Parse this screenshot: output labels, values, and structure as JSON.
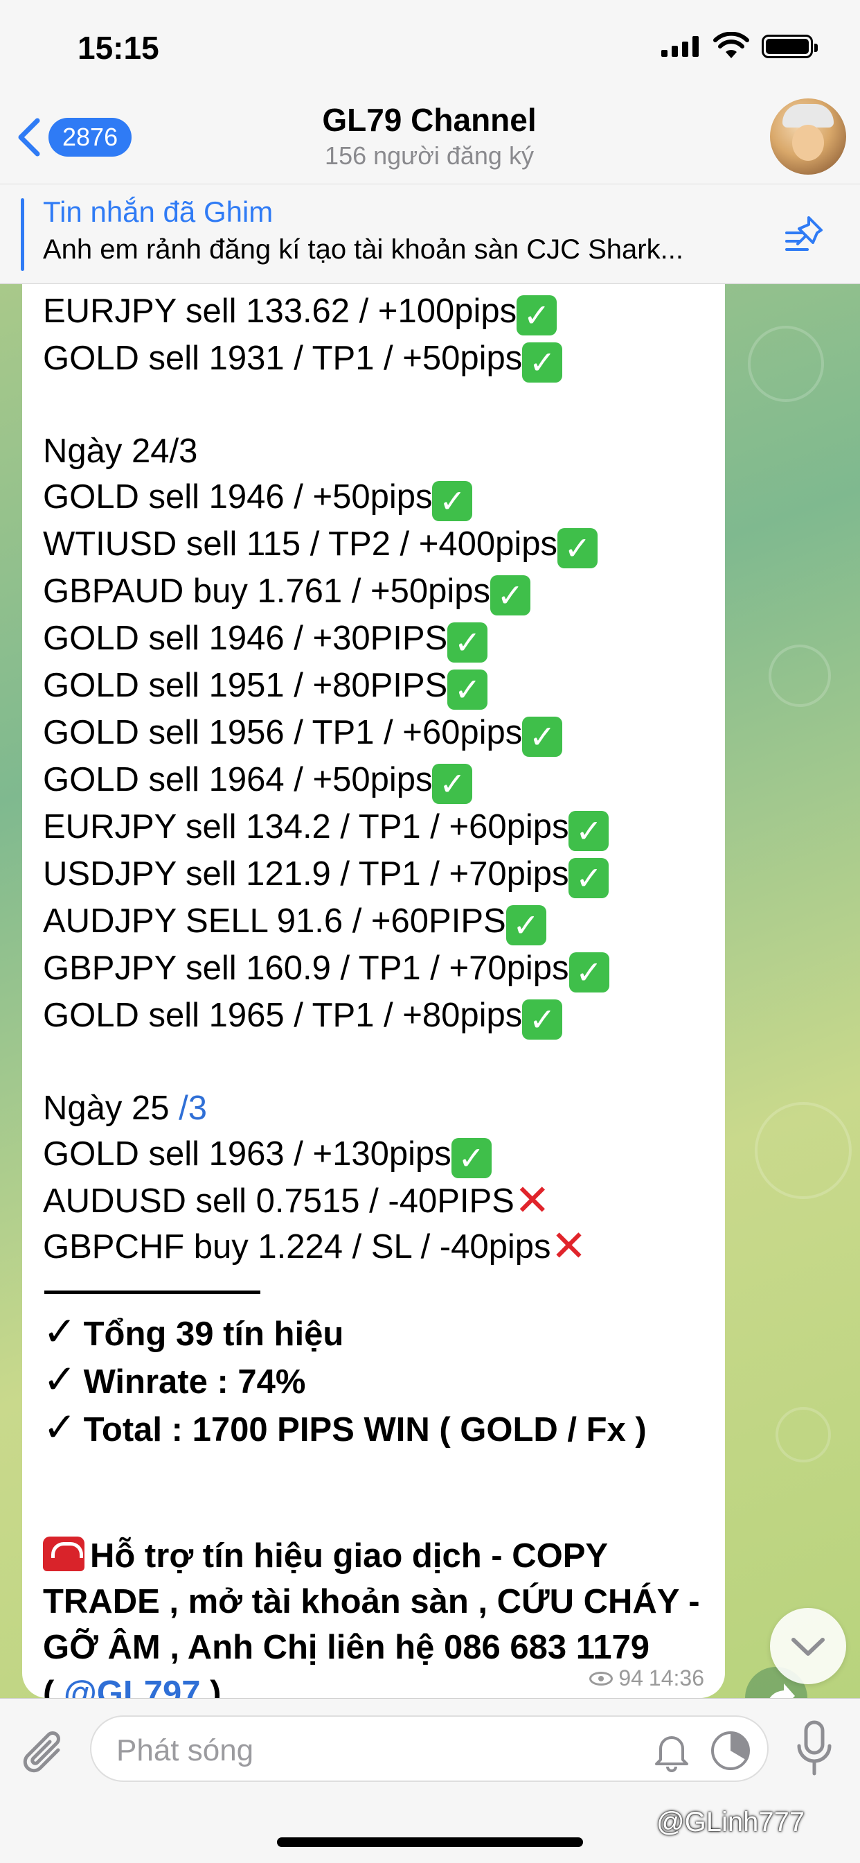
{
  "status": {
    "time": "15:15"
  },
  "header": {
    "back_count": "2876",
    "title": "GL79 Channel",
    "subtitle": "156 người đăng ký"
  },
  "pinned": {
    "title": "Tin nhắn đã Ghim",
    "text": "Anh em rảnh đăng kí tạo tài khoản sàn CJC Shark..."
  },
  "message": {
    "lines_top": [
      {
        "text": "EURJPY sell 133.62 / +100pips",
        "result": "win"
      },
      {
        "text": "GOLD sell 1931 / TP1 / +50pips",
        "result": "win"
      }
    ],
    "day1": {
      "heading": "Ngày 24/3",
      "lines": [
        {
          "text": "GOLD sell 1946 / +50pips",
          "result": "win"
        },
        {
          "text": "WTIUSD sell 115 / TP2 / +400pips",
          "result": "win"
        },
        {
          "text": "GBPAUD buy 1.761 / +50pips",
          "result": "win"
        },
        {
          "text": "GOLD sell 1946 / +30PIPS",
          "result": "win"
        },
        {
          "text": "GOLD sell 1951 / +80PIPS",
          "result": "win"
        },
        {
          "text": "GOLD sell 1956 / TP1 / +60pips",
          "result": "win"
        },
        {
          "text": "GOLD sell 1964 / +50pips",
          "result": "win"
        },
        {
          "text": "EURJPY sell 134.2 / TP1 / +60pips",
          "result": "win"
        },
        {
          "text": "USDJPY sell 121.9 / TP1 / +70pips",
          "result": "win"
        },
        {
          "text": "AUDJPY SELL 91.6 / +60PIPS",
          "result": "win"
        },
        {
          "text": "GBPJPY sell 160.9 / TP1 / +70pips",
          "result": "win"
        },
        {
          "text": "GOLD sell 1965 / TP1 / +80pips",
          "result": "win"
        }
      ]
    },
    "day2": {
      "heading_a": "Ngày 25 ",
      "heading_b": "/3",
      "lines": [
        {
          "text": "GOLD sell 1963 / +130pips",
          "result": "win"
        },
        {
          "text": "AUDUSD sell 0.7515 / -40PIPS",
          "result": "loss"
        },
        {
          "text": "GBPCHF buy 1.224 / SL / -40pips",
          "result": "loss"
        }
      ]
    },
    "summary": [
      "Tổng  39 tín hiệu",
      "Winrate : 74%",
      "Total :  1700 PIPS WIN ( GOLD / Fx )"
    ],
    "contact_text": "Hỗ trợ tín hiệu giao dịch - COPY TRADE , mở tài khoản sàn , CỨU CHÁY - GỠ ÂM , Anh Chị liên hệ 086 683 1179",
    "contact_open": "( ",
    "contact_link": "@GL797",
    "contact_close": " )",
    "views": "94",
    "time": "14:36"
  },
  "input": {
    "placeholder": "Phát sóng"
  },
  "watermark": "@GLinh777",
  "colors": {
    "accent": "#2f7bf5",
    "check_green": "#3fbf4a",
    "cross_red": "#e0242b"
  }
}
